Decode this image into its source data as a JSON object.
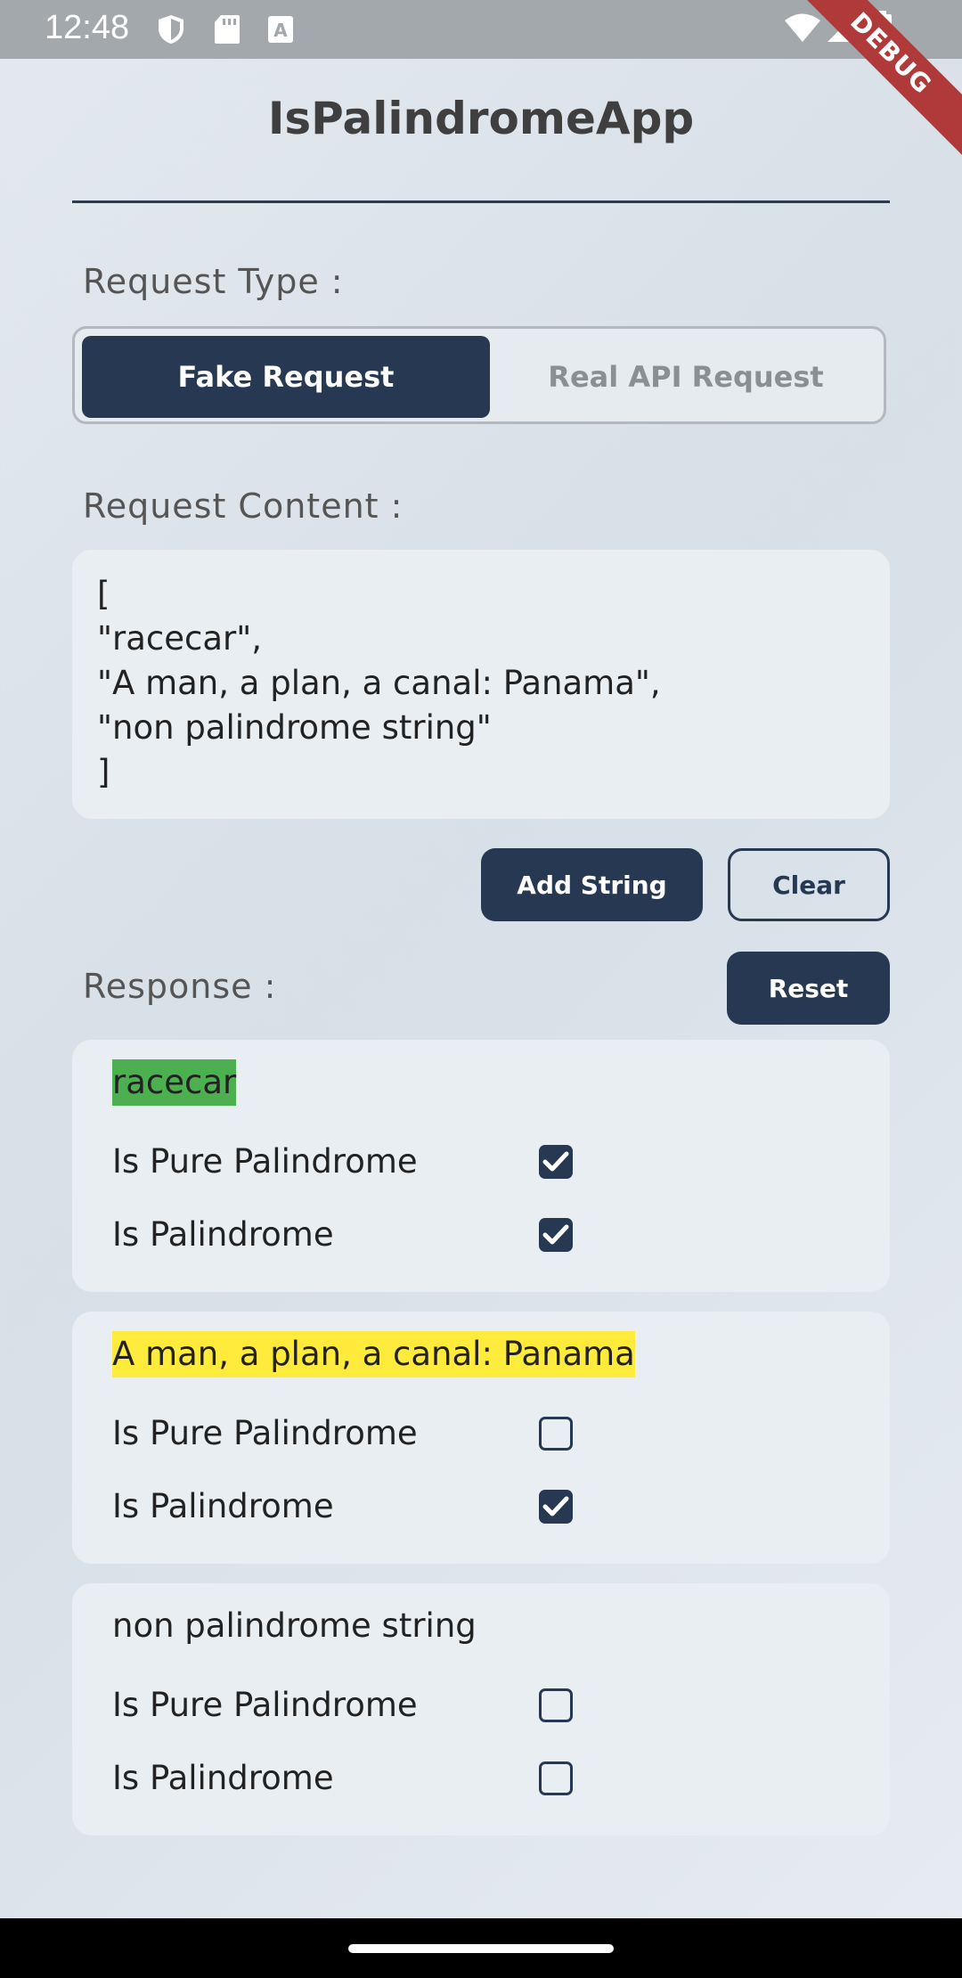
{
  "status_bar": {
    "time": "12:48",
    "debug_label": "DEBUG"
  },
  "app": {
    "title": "IsPalindromeApp"
  },
  "request_type": {
    "label": "Request Type :",
    "options": [
      "Fake Request",
      "Real API Request"
    ],
    "selected": "Fake Request"
  },
  "request_content": {
    "label": "Request Content :",
    "lines": [
      "[",
      "\"racecar\",",
      "\"A man, a plan, a canal: Panama\",",
      "\"non palindrome string\"",
      "]"
    ]
  },
  "buttons": {
    "add_string": "Add String",
    "clear": "Clear",
    "reset": "Reset"
  },
  "response": {
    "label": "Response :",
    "results": [
      {
        "text": "racecar",
        "highlight": "#4caf50",
        "rows": [
          {
            "label": "Is Pure Palindrome",
            "checked": true
          },
          {
            "label": "Is Palindrome",
            "checked": true
          }
        ]
      },
      {
        "text": "A man, a plan, a canal: Panama",
        "highlight": "#ffeb3b",
        "rows": [
          {
            "label": "Is Pure Palindrome",
            "checked": false
          },
          {
            "label": "Is Palindrome",
            "checked": true
          }
        ]
      },
      {
        "text": "non palindrome string",
        "highlight": "",
        "rows": [
          {
            "label": "Is Pure Palindrome",
            "checked": false
          },
          {
            "label": "Is Palindrome",
            "checked": false
          }
        ]
      }
    ]
  },
  "colors": {
    "primary": "#263852",
    "highlight_green": "#4caf50",
    "highlight_yellow": "#ffeb3b"
  }
}
